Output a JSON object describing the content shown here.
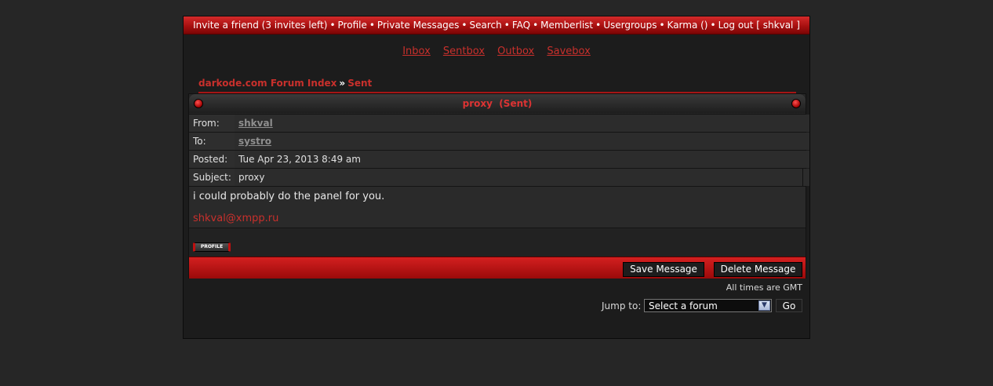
{
  "nav": {
    "items": [
      "Invite a friend (3 invites left)",
      "Profile",
      "Private Messages",
      "Search",
      "FAQ",
      "Memberlist",
      "Usergroups",
      "Karma ()",
      "Log out [ shkval ]"
    ],
    "separator": "•"
  },
  "pm_tabs": [
    "Inbox",
    "Sentbox",
    "Outbox",
    "Savebox"
  ],
  "breadcrumb": {
    "index": "darkode.com Forum Index",
    "sep": "»",
    "current": "Sent"
  },
  "message": {
    "title": "proxy  (Sent)",
    "from_label": "From:",
    "from": "shkval",
    "to_label": "To:",
    "to": "systro",
    "posted_label": "Posted:",
    "posted": "Tue Apr 23, 2013 8:49 am",
    "subject_label": "Subject:",
    "subject": "proxy",
    "body": "i could probably do the panel for you.",
    "signature": "shkval@xmpp.ru",
    "profile_button": "PROFILE"
  },
  "actions": {
    "save": "Save Message",
    "delete": "Delete Message"
  },
  "footer": {
    "timezone": "All times are GMT",
    "jump_label": "Jump to:",
    "jump_value": "Select a forum",
    "go": "Go"
  },
  "colors": {
    "accent": "#c9302c",
    "bar": "#b01515",
    "bg": "#262626"
  }
}
